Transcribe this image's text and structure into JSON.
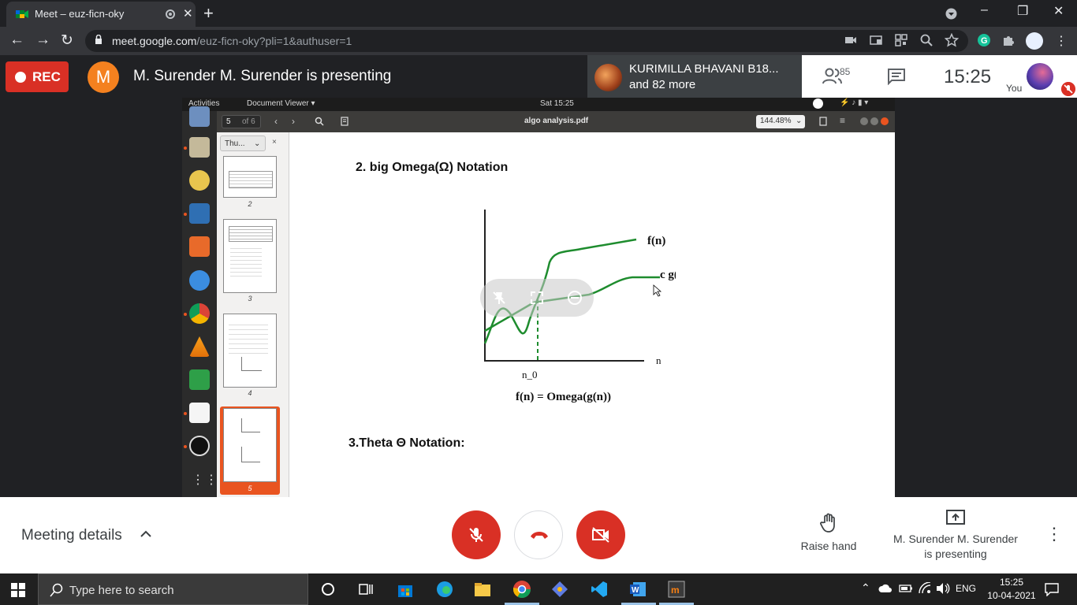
{
  "browser": {
    "tab_title": "Meet – euz-ficn-oky",
    "new_tab_label": "+",
    "url_host": "meet.google.com",
    "url_path": "/euz-ficn-oky?pli=1&authuser=1",
    "window_controls": [
      "–",
      "❐",
      "✕"
    ]
  },
  "meet": {
    "rec_label": "REC",
    "presenter_initial": "M",
    "presenting_title": "M. Surender M. Surender is presenting",
    "speaker_line1": "KURIMILLA BHAVANI B18...",
    "speaker_line2": "and 82 more",
    "participant_count": "85",
    "clock": "15:25",
    "you_label": "You"
  },
  "shared_screen": {
    "topbar_activities": "Activities",
    "topbar_app": "Document Viewer ▾",
    "topbar_time": "Sat 15:25",
    "current_page": "5",
    "total_pages": "of 6",
    "doc_title": "algo analysis.pdf",
    "zoom": "144.48%",
    "sidebar_combo": "Thu...",
    "sidebar_close": "×",
    "thumb_numbers": [
      "2",
      "3",
      "4",
      "5"
    ],
    "heading_omega": "2. big Omega(Ω) Notation",
    "graph_label_f": "f(n)",
    "graph_label_cg": "c g(n)",
    "graph_label_n": "n",
    "graph_label_n0": "n_0",
    "formula": "f(n) = Omega(g(n))",
    "heading_theta": "3.Theta Θ Notation:"
  },
  "controls": {
    "meeting_details": "Meeting details",
    "raise_hand": "Raise hand",
    "present_line1": "M. Surender M. Surender",
    "present_line2": "is presenting"
  },
  "taskbar": {
    "search_placeholder": "Type here to search",
    "lang": "ENG",
    "time": "15:25",
    "date": "10-04-2021"
  },
  "colors": {
    "meet_red": "#d93025",
    "avatar_orange": "#f4811f",
    "graph_green": "#1e8c2e",
    "ubuntu_orange": "#e95420"
  }
}
